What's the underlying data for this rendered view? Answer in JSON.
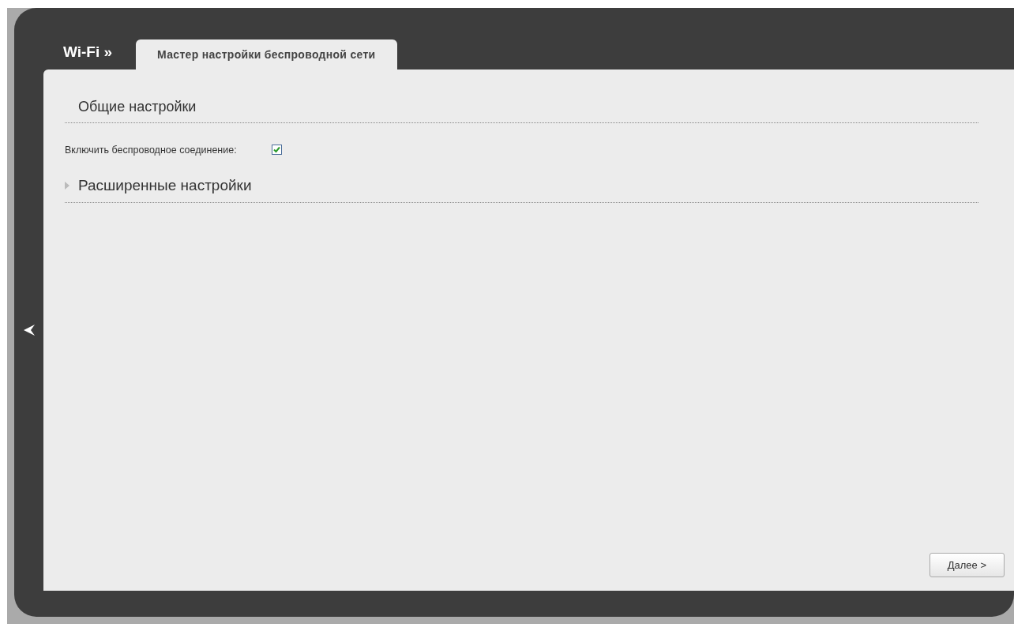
{
  "breadcrumb": "Wi-Fi »",
  "tabs": [
    {
      "label": "Мастер настройки беспроводной сети",
      "selected": true
    }
  ],
  "sections": [
    {
      "kind": "group",
      "title": "Общие настройки",
      "fields": [
        {
          "label": "Включить беспроводное соединение:",
          "checked": true
        }
      ]
    },
    {
      "kind": "collapsible",
      "title": "Расширенные настройки",
      "expanded": false
    }
  ],
  "buttons": [
    {
      "label": "Далее >"
    }
  ]
}
